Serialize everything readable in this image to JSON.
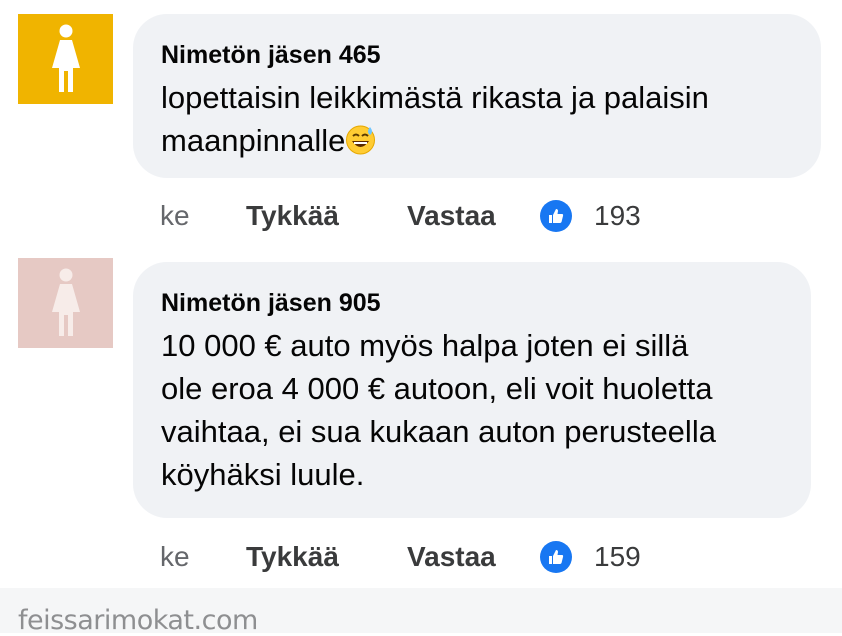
{
  "comments": [
    {
      "author": "Nimetön jäsen 465",
      "lines": [
        "lopettaisin leikkimästä rikasta ja palaisin",
        "maanpinnalle"
      ],
      "emoji": "sweat-smile-emoji",
      "time": "ke",
      "like_label": "Tykkää",
      "reply_label": "Vastaa",
      "like_count": "193",
      "avatar_color": "#f0b400"
    },
    {
      "author": "Nimetön jäsen 905",
      "lines": [
        "10 000 € auto myös halpa joten ei sillä",
        "ole eroa 4 000 € autoon, eli voit huoletta",
        "vaihtaa, ei sua kukaan auton perusteella",
        "köyhäksi luule."
      ],
      "time": "ke",
      "like_label": "Tykkää",
      "reply_label": "Vastaa",
      "like_count": "159",
      "avatar_color": "#e6c9c4"
    }
  ],
  "footer": {
    "watermark": "feissarimokat.com"
  },
  "colors": {
    "bubble": "#f0f2f5",
    "like_badge": "#1877f2",
    "muted": "#65676b"
  }
}
